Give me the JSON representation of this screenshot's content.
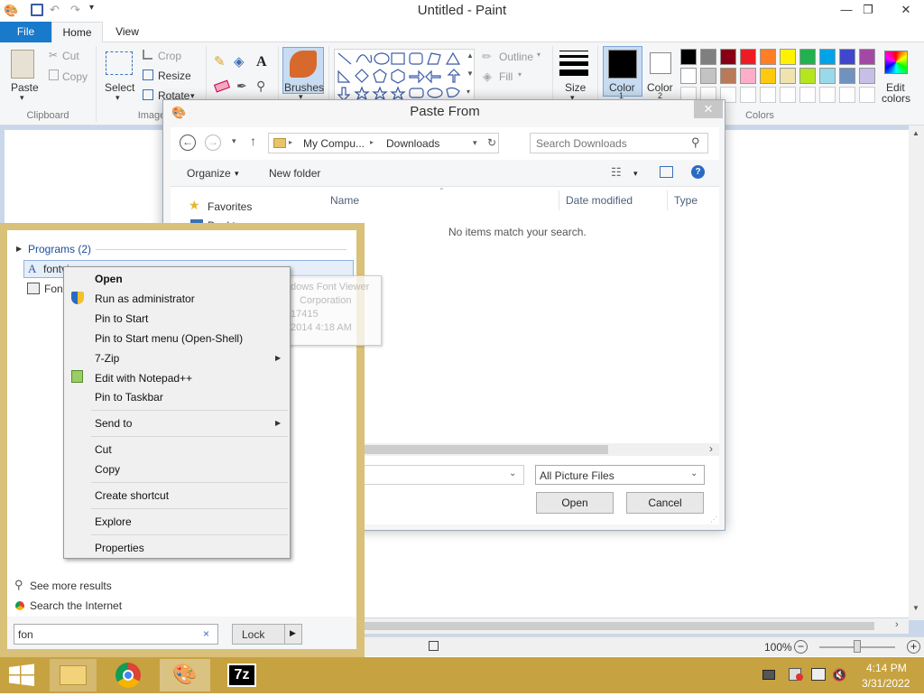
{
  "window": {
    "title": "Untitled - Paint",
    "min": "—",
    "max": "❐",
    "close": "✕"
  },
  "ribbon": {
    "tabs": {
      "file": "File",
      "home": "Home",
      "view": "View"
    },
    "clipboard": {
      "paste": "Paste",
      "cut": "Cut",
      "copy": "Copy",
      "group": "Clipboard"
    },
    "image": {
      "select": "Select",
      "crop": "Crop",
      "resize": "Resize",
      "rotate": "Rotate",
      "group": "Image"
    },
    "brushes": "Brushes",
    "shapes": {
      "outline": "Outline",
      "fill": "Fill"
    },
    "size": "Size",
    "color1_top": "Color",
    "color1_bottom": "1",
    "color2_top": "Color",
    "color2_bottom": "2",
    "edit_colors_top": "Edit",
    "edit_colors_bottom": "colors",
    "colors_group": "Colors",
    "palette_row1": [
      "#000000",
      "#7f7f7f",
      "#880015",
      "#ed1c24",
      "#ff7f27",
      "#fff200",
      "#22b14c",
      "#00a2e8",
      "#3f48cc",
      "#a349a4"
    ],
    "palette_row2": [
      "#ffffff",
      "#c3c3c3",
      "#b97a57",
      "#ffaec9",
      "#ffc90e",
      "#efe4b0",
      "#b5e61d",
      "#99d9ea",
      "#7092be",
      "#c8bfe7"
    ]
  },
  "dialog": {
    "title": "Paste From",
    "breadcrumb": [
      "My Compu...",
      "Downloads"
    ],
    "search_placeholder": "Search Downloads",
    "organize": "Organize",
    "new_folder": "New folder",
    "col_name": "Name",
    "col_date": "Date modified",
    "col_type": "Type",
    "nav_favorites": "Favorites",
    "nav_desktop": "Deskt",
    "empty_msg": "No items match your search.",
    "file_type": "All Picture Files",
    "open": "Open",
    "cancel": "Cancel"
  },
  "search": {
    "section": "Programs (2)",
    "result1": "fontview",
    "result2": "Fon",
    "tooltip": [
      "dows Font Viewer",
      "Corporation",
      "17415",
      "2014 4:18 AM"
    ],
    "see_more": "See more results",
    "search_internet": "Search the Internet",
    "query": "fon",
    "lock": "Lock"
  },
  "context_menu": {
    "open": "Open",
    "run_admin": "Run as administrator",
    "pin_start": "Pin to Start",
    "pin_start_menu": "Pin to Start menu (Open-Shell)",
    "zip": "7-Zip",
    "notepad": "Edit with Notepad++",
    "pin_taskbar": "Pin to Taskbar",
    "send_to": "Send to",
    "cut": "Cut",
    "copy": "Copy",
    "create_shortcut": "Create shortcut",
    "explore": "Explore",
    "properties": "Properties"
  },
  "status": {
    "zoom": "100%"
  },
  "taskbar": {
    "time": "4:14 PM",
    "date": "3/31/2022",
    "zip_label": "7z"
  }
}
